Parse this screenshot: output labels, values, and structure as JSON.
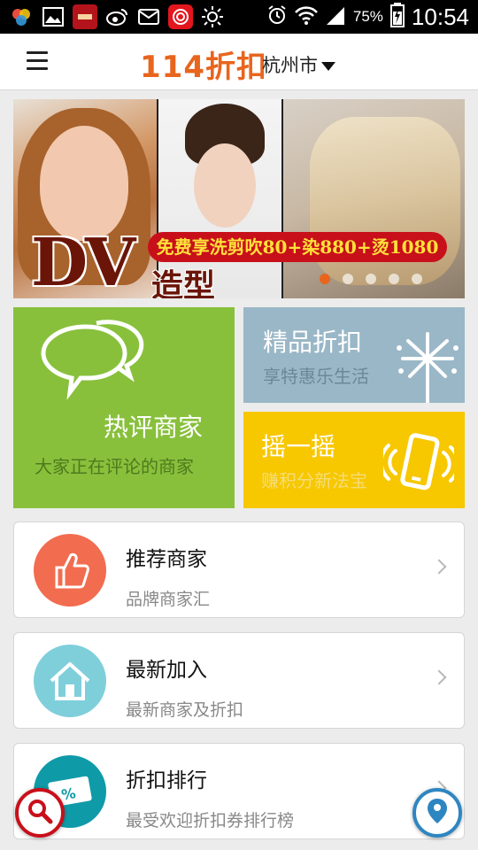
{
  "status_bar": {
    "battery": "75%",
    "time": "10:54",
    "icons": [
      "app-icon",
      "gallery-icon",
      "app-icon",
      "weibo-icon",
      "mail-icon",
      "app-icon",
      "brightness-icon",
      "alarm-icon",
      "wifi-icon",
      "signal-icon",
      "battery-icon"
    ]
  },
  "header": {
    "logo": "114折扣",
    "city": "杭州市"
  },
  "banner": {
    "big_text": "DV",
    "sub_text": "造型",
    "promo": "免费享洗剪吹80+染880+烫1080",
    "slides": 5,
    "active_slide": 1
  },
  "tiles": {
    "reviews": {
      "title": "热评商家",
      "subtitle": "大家正在评论的商家"
    },
    "premium": {
      "title": "精品折扣",
      "subtitle": "享特惠乐生活"
    },
    "shake": {
      "title": "摇一摇",
      "subtitle": "赚积分新法宝"
    }
  },
  "list": [
    {
      "title": "推荐商家",
      "subtitle": "品牌商家汇"
    },
    {
      "title": "最新加入",
      "subtitle": "最新商家及折扣"
    },
    {
      "title": "折扣排行",
      "subtitle": "最受欢迎折扣券排行榜"
    }
  ],
  "colors": {
    "brand": "#e8651e",
    "tile_green": "#88c03c",
    "tile_blue": "#9ab7c7",
    "tile_yellow": "#f7c700",
    "circle_recommend": "#f26c4f",
    "circle_new": "#7fcfdb",
    "circle_rank": "#0f9aa8"
  }
}
